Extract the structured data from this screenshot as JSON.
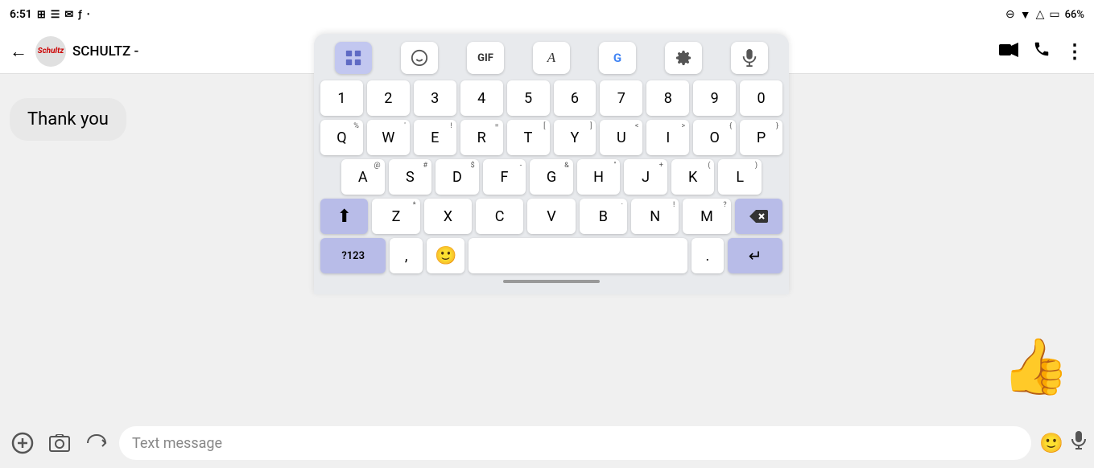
{
  "statusBar": {
    "time": "6:51",
    "battery": "66%",
    "signal": "▲"
  },
  "header": {
    "contactName": "SCHULTZ -",
    "backLabel": "←",
    "videoIcon": "📹",
    "phoneIcon": "📞",
    "moreIcon": "⋮"
  },
  "message": {
    "text": "Thank you"
  },
  "inputBar": {
    "placeholder": "Text message",
    "addIcon": "+",
    "photoIcon": "🖼",
    "arIcon": "↺"
  },
  "keyboard": {
    "toolbar": [
      {
        "id": "emoji-grid",
        "label": "⊞",
        "active": true
      },
      {
        "id": "sticker",
        "label": "😊"
      },
      {
        "id": "gif",
        "label": "GIF",
        "isText": true
      },
      {
        "id": "spell",
        "label": "A→"
      },
      {
        "id": "translate",
        "label": "G→"
      },
      {
        "id": "settings",
        "label": "⚙"
      },
      {
        "id": "voice",
        "label": "🎤"
      }
    ],
    "numberRow": [
      "1",
      "2",
      "3",
      "4",
      "5",
      "6",
      "7",
      "8",
      "9",
      "0"
    ],
    "row1": [
      {
        "key": "Q",
        "sub": "%"
      },
      {
        "key": "W",
        "sub": "'"
      },
      {
        "key": "E",
        "sub": "!"
      },
      {
        "key": "R",
        "sub": "="
      },
      {
        "key": "T",
        "sub": "["
      },
      {
        "key": "Y",
        "sub": "]"
      },
      {
        "key": "U",
        "sub": "<"
      },
      {
        "key": "I",
        "sub": ">"
      },
      {
        "key": "O",
        "sub": "{"
      },
      {
        "key": "P",
        "sub": "}"
      }
    ],
    "row2": [
      {
        "key": "A",
        "sub": "@"
      },
      {
        "key": "S",
        "sub": "#"
      },
      {
        "key": "D",
        "sub": "$"
      },
      {
        "key": "F",
        "sub": "-"
      },
      {
        "key": "G",
        "sub": "&"
      },
      {
        "key": "H",
        "sub": "\""
      },
      {
        "key": "J",
        "sub": "+"
      },
      {
        "key": "K",
        "sub": "("
      },
      {
        "key": "L",
        "sub": ")"
      }
    ],
    "row3": [
      {
        "key": "Z",
        "sub": "*"
      },
      {
        "key": "X",
        "sub": ""
      },
      {
        "key": "C",
        "sub": ""
      },
      {
        "key": "V",
        "sub": ""
      },
      {
        "key": "B",
        "sub": "·"
      },
      {
        "key": "N",
        "sub": "!"
      },
      {
        "key": "M",
        "sub": "?"
      }
    ],
    "bottomRow": {
      "numSym": "?123",
      "comma": ",",
      "emoji": "😊",
      "space": "",
      "period": ".",
      "enter": "↵"
    }
  },
  "thumbsUp": "👍"
}
